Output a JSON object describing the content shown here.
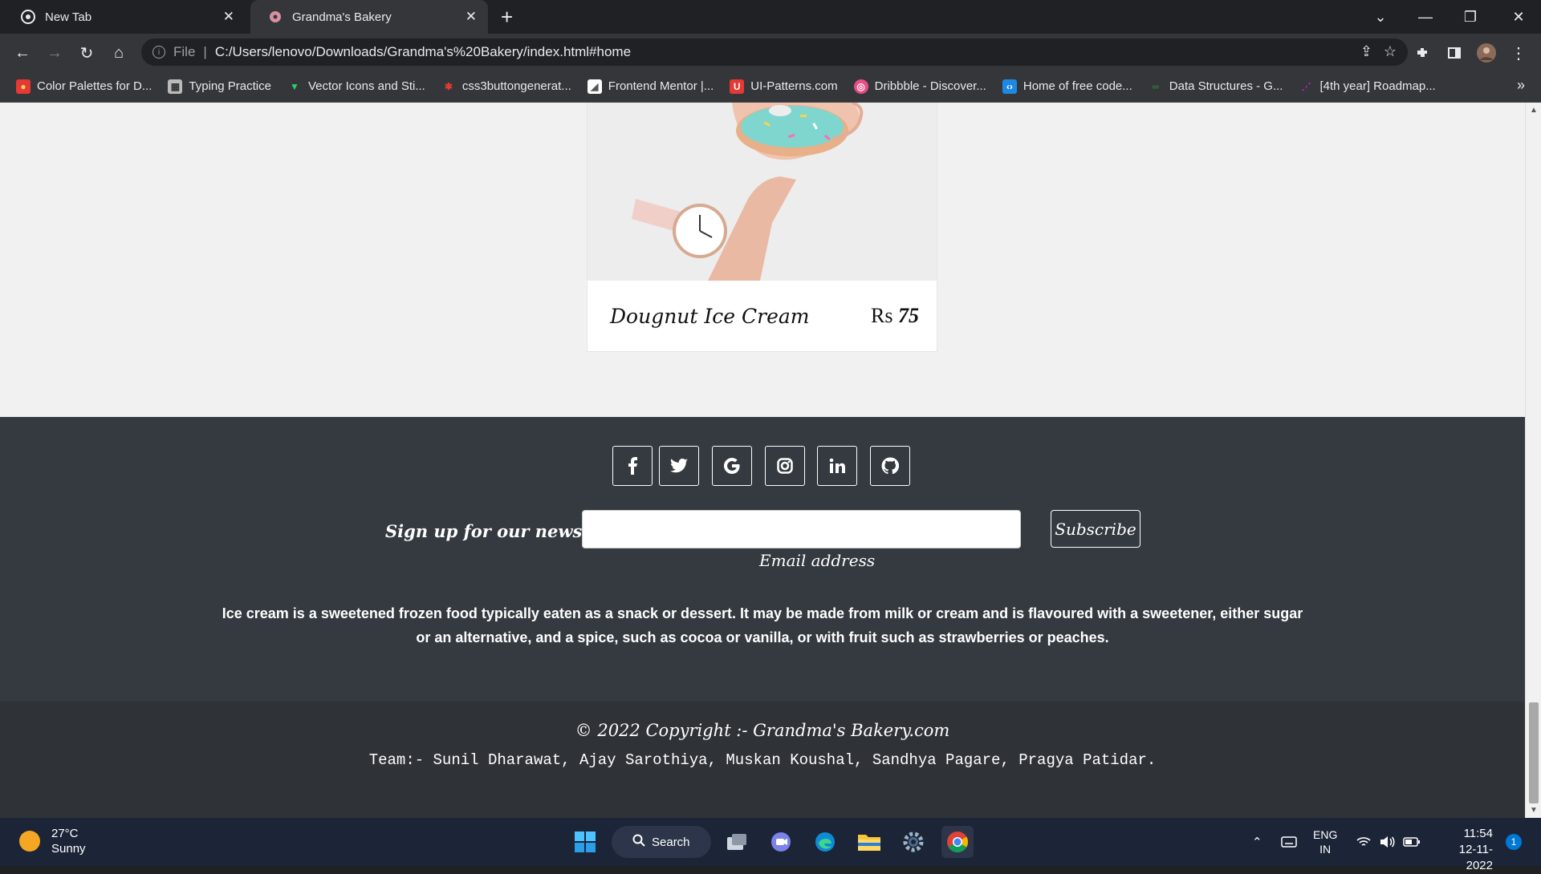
{
  "browser": {
    "tabs": [
      {
        "title": "New Tab"
      },
      {
        "title": "Grandma's Bakery"
      }
    ],
    "address": {
      "scheme_label": "File",
      "url": "C:/Users/lenovo/Downloads/Grandma's%20Bakery/index.html#home"
    },
    "bookmarks": [
      {
        "label": "Color Palettes for D..."
      },
      {
        "label": "Typing Practice"
      },
      {
        "label": "Vector Icons and Sti..."
      },
      {
        "label": "css3buttongenerat..."
      },
      {
        "label": "Frontend Mentor |..."
      },
      {
        "label": "UI-Patterns.com"
      },
      {
        "label": "Dribbble - Discover..."
      },
      {
        "label": "Home of free code..."
      },
      {
        "label": "Data Structures - G..."
      },
      {
        "label": "[4th year] Roadmap..."
      }
    ],
    "more_bookmarks": "»"
  },
  "product": {
    "name": "Dougnut Ice Cream",
    "currency": "Rs",
    "price": "75"
  },
  "footer": {
    "social_icons": [
      "facebook-icon",
      "twitter-icon",
      "google-icon",
      "instagram-icon",
      "linkedin-icon",
      "github-icon"
    ],
    "newsletter": {
      "label": "Sign up for our newsletter",
      "email_hint": "Email address",
      "button": "Subscribe"
    },
    "about": "Ice cream is a sweetened frozen food typically eaten as a snack or dessert. It may be made from milk or cream and is flavoured with a sweetener, either sugar or an alternative, and a spice, such as cocoa or vanilla, or with fruit such as strawberries or peaches.",
    "copyright": "© 2022 Copyright :- Grandma's Bakery.com",
    "team": "Team:- Sunil Dharawat, Ajay Sarothiya, Muskan Koushal, Sandhya Pagare, Pragya Patidar."
  },
  "taskbar": {
    "weather": {
      "temp": "27°C",
      "condition": "Sunny"
    },
    "search_label": "Search",
    "lang": {
      "line1": "ENG",
      "line2": "IN"
    },
    "time": "11:54",
    "date": "12-11-2022",
    "notification_count": "1"
  },
  "colors": {
    "footer_bg": "#343a40",
    "copyright_bg": "#2f3338",
    "page_bg": "#f1f1f1",
    "chrome_dark": "#202124",
    "chrome_toolbar": "#35363a"
  }
}
